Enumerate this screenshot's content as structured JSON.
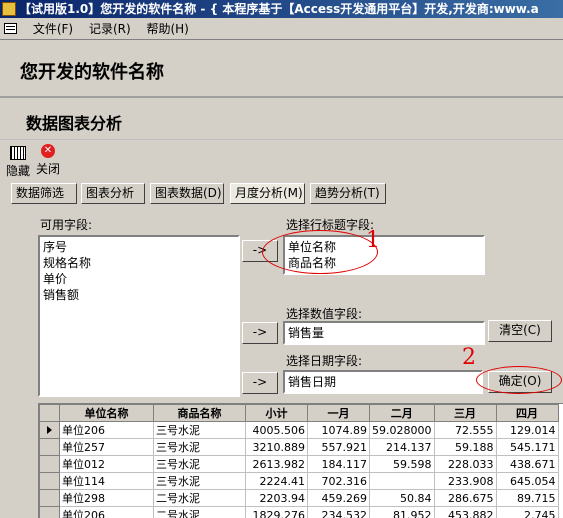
{
  "window": {
    "title": "【试用版1.0】您开发的软件名称 - { 本程序基于【Access开发通用平台】开发,开发商:www.a"
  },
  "menu": {
    "items": [
      "文件(F)",
      "记录(R)",
      "帮助(H)"
    ]
  },
  "header": {
    "app_name": "您开发的软件名称",
    "page_title": "数据图表分析"
  },
  "toolbar": {
    "hide_label": "隐藏",
    "close_label": "关闭"
  },
  "tabs": [
    "数据筛选",
    "图表分析",
    "图表数据(D)",
    "月度分析(M)",
    "趋势分析(T)"
  ],
  "active_tab": "月度分析(M)",
  "fields": {
    "available_label": "可用字段:",
    "available": [
      "序号",
      "规格名称",
      "单价",
      "销售额"
    ],
    "row_header_label": "选择行标题字段:",
    "row_header": [
      "单位名称",
      "商品名称"
    ],
    "value_label": "选择数值字段:",
    "value": "销售量",
    "date_label": "选择日期字段:",
    "date": "销售日期"
  },
  "buttons": {
    "arrow": "->",
    "clear": "清空(C)",
    "ok": "确定(O)"
  },
  "annotations": [
    "1",
    "2"
  ],
  "grid": {
    "columns": [
      "单位名称",
      "商品名称",
      "小计",
      "一月",
      "二月",
      "三月",
      "四月"
    ],
    "rows": [
      [
        "单位206",
        "三号水泥",
        "4005.506",
        "1074.89",
        "59.028000",
        "72.555",
        "129.014"
      ],
      [
        "单位257",
        "三号水泥",
        "3210.889",
        "557.921",
        "214.137",
        "59.188",
        "545.171"
      ],
      [
        "单位012",
        "三号水泥",
        "2613.982",
        "184.117",
        "59.598",
        "228.033",
        "438.671"
      ],
      [
        "单位114",
        "三号水泥",
        "2224.41",
        "702.316",
        "",
        "233.908",
        "645.054"
      ],
      [
        "单位298",
        "二号水泥",
        "2203.94",
        "459.269",
        "50.84",
        "286.675",
        "89.715"
      ],
      [
        "单位206",
        "二号水泥",
        "1829.276",
        "234.532",
        "81.952",
        "453.882",
        "2.745"
      ]
    ]
  }
}
